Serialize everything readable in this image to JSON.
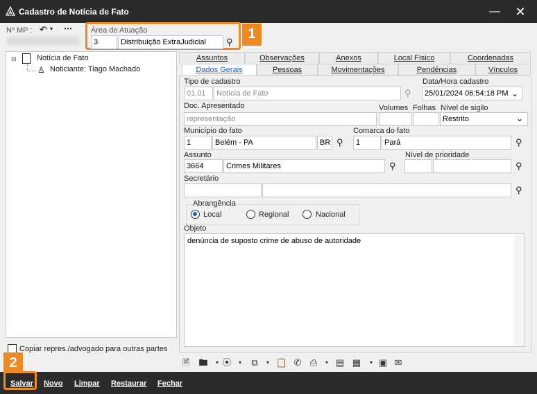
{
  "window": {
    "title": "Cadastro de Notícia de Fato"
  },
  "header": {
    "mp_label": "Nº MP :",
    "area_label": "Área de Atuação",
    "area_code": "3",
    "area_name": "Distribuição ExtraJudicial"
  },
  "annotations": {
    "one": "1",
    "two": "2"
  },
  "tree": {
    "root": "Notícia de Fato",
    "child": "Noticiante: Tiago Machado"
  },
  "copy_checkbox": "Copiar repres./advogado para outras partes",
  "tabs_row1": [
    "Assuntos",
    "Observações",
    "Anexos",
    "Local Físico",
    "Coordenadas"
  ],
  "tabs_row2": [
    "Dados Gerais",
    "Pessoas",
    "Movimentações",
    "Pendências",
    "Vínculos"
  ],
  "form": {
    "tipo_label": "Tipo de cadastro",
    "tipo_code": "01.01",
    "tipo_name": "Notícia de Fato",
    "data_label": "Data/Hora cadastro",
    "data_value": "25/01/2024 06:54:18 PM",
    "doc_label": "Doc. Apresentado",
    "doc_value": "representação",
    "volumes_label": "Volumes",
    "folhas_label": "Folhas",
    "sigilo_label": "Nível de sigilo",
    "sigilo_value": "Restrito",
    "municipio_label": "Município do fato",
    "municipio_code": "1",
    "municipio_name": "Belém - PA",
    "municipio_uf": "BR",
    "comarca_label": "Comarca do fato",
    "comarca_code": "1",
    "comarca_name": "Pará",
    "assunto_label": "Assunto",
    "assunto_code": "3664",
    "assunto_name": "Crimes Militares",
    "prioridade_label": "Nível de prioridade",
    "secretario_label": "Secretário",
    "abrangencia_label": "Abrangência",
    "abrangencia_options": [
      "Local",
      "Regional",
      "Nacional"
    ],
    "abrangencia_selected": "Local",
    "objeto_label": "Objeto",
    "objeto_value": "denúncia de suposto crime de abuso de autoridade"
  },
  "bottom_buttons": [
    "Salvar",
    "Novo",
    "Limpar",
    "Restaurar",
    "Fechar"
  ],
  "colors": {
    "accent": "#ee8a24",
    "titlebar": "#2b2b2b",
    "link": "#1f5fbf"
  }
}
